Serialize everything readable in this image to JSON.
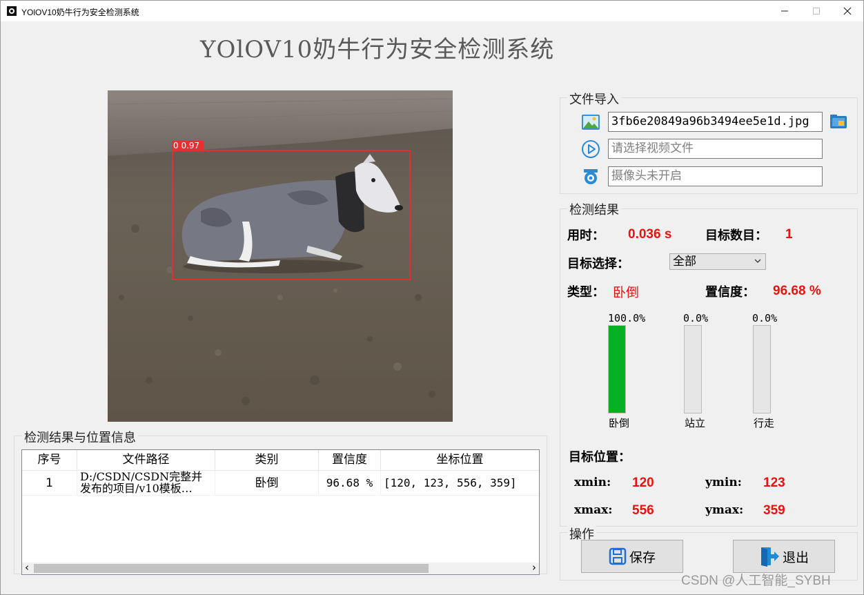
{
  "window": {
    "title": "YOlOV10奶牛行为安全检测系统",
    "minimize": "─",
    "maximize": "☐",
    "close": "✕"
  },
  "app_title": "YOlOV10奶牛行为安全检测系统",
  "detection": {
    "label": "0 0.97",
    "box_color": "#e03030"
  },
  "file_import": {
    "title": "文件导入",
    "image_path": "3fb6e20849a96b3494ee5e1d.jpg",
    "video_placeholder": "请选择视频文件",
    "camera_placeholder": "摄像头未开启"
  },
  "results": {
    "title": "检测结果",
    "time_label": "用时：",
    "time_value": "0.036 s",
    "count_label": "目标数目：",
    "count_value": "1",
    "select_label": "目标选择：",
    "select_value": "全部",
    "type_label": "类型：",
    "type_value": "卧倒",
    "conf_label": "置信度：",
    "conf_value": "96.68 %",
    "bars": [
      {
        "name": "卧倒",
        "pct_text": "100.0%",
        "fraction": 1.0
      },
      {
        "name": "站立",
        "pct_text": "0.0%",
        "fraction": 0.0
      },
      {
        "name": "行走",
        "pct_text": "0.0%",
        "fraction": 0.0
      }
    ],
    "position_label": "目标位置：",
    "xmin_label": "xmin:",
    "xmin_value": "120",
    "ymin_label": "ymin:",
    "ymin_value": "123",
    "xmax_label": "xmax:",
    "xmax_value": "556",
    "ymax_label": "ymax:",
    "ymax_value": "359",
    "accent_color": "#e8130e",
    "bar_color": "#06b025"
  },
  "operations": {
    "title": "操作",
    "save": "保存",
    "exit": "退出"
  },
  "table": {
    "title": "检测结果与位置信息",
    "headers": [
      "序号",
      "文件路径",
      "类别",
      "置信度",
      "坐标位置"
    ],
    "rows": [
      {
        "index": "1",
        "path_line1": "D:/CSDN/CSDN完整并",
        "path_line2": "发布的项目/v10模板…",
        "category": "卧倒",
        "confidence": "96.68 %",
        "coords": "[120, 123, 556, 359]"
      }
    ],
    "scroll_left": "‹",
    "scroll_right": "›"
  },
  "watermark": "CSDN @人工智能_SYBH"
}
